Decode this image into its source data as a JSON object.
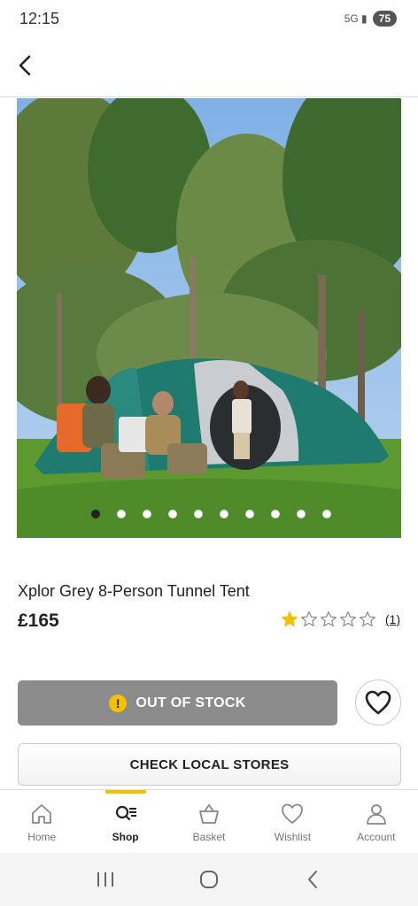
{
  "status_bar": {
    "time": "12:15",
    "icons": "5G ▮",
    "battery": "75"
  },
  "product": {
    "title": "Xplor Grey 8-Person Tunnel Tent",
    "price": "£165",
    "rating": 1,
    "rating_max": 5,
    "review_count": "(1)",
    "image_count": 10,
    "active_image": 1
  },
  "actions": {
    "out_of_stock_label": "OUT OF STOCK",
    "alert_glyph": "!",
    "check_stores_label": "CHECK LOCAL STORES"
  },
  "bottom_nav": {
    "items": [
      {
        "label": "Home",
        "icon": "home-icon"
      },
      {
        "label": "Shop",
        "icon": "search-list-icon",
        "active": true
      },
      {
        "label": "Basket",
        "icon": "basket-icon"
      },
      {
        "label": "Wishlist",
        "icon": "heart-icon"
      },
      {
        "label": "Account",
        "icon": "user-icon"
      }
    ]
  },
  "colors": {
    "accent": "#f2c200",
    "star": "#f2c200",
    "oos": "#8c8c8c"
  }
}
